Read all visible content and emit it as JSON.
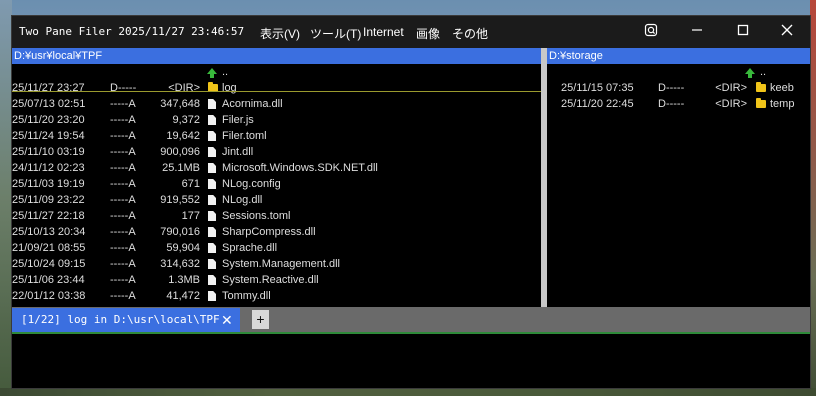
{
  "window": {
    "title": "Two Pane Filer 2025/11/27 23:46:57",
    "menu": [
      "表示(V)",
      "ツール(T)",
      "Internet",
      "画像",
      "その他"
    ]
  },
  "left_pane": {
    "path": "D:¥usr¥local¥TPF",
    "parent": "..",
    "entries": [
      {
        "date": "25/11/27 23:27",
        "attr": "D-----",
        "size": "<DIR>",
        "type": "folder",
        "name": "log"
      },
      {
        "date": "25/07/13 02:51",
        "attr": "-----A",
        "size": "347,648",
        "type": "file",
        "name": "Acornima.dll"
      },
      {
        "date": "25/11/20 23:20",
        "attr": "-----A",
        "size": "9,372",
        "type": "file",
        "name": "Filer.js"
      },
      {
        "date": "25/11/24 19:54",
        "attr": "-----A",
        "size": "19,642",
        "type": "file",
        "name": "Filer.toml"
      },
      {
        "date": "25/11/10 03:19",
        "attr": "-----A",
        "size": "900,096",
        "type": "file",
        "name": "Jint.dll"
      },
      {
        "date": "24/11/12 02:23",
        "attr": "-----A",
        "size": "25.1MB",
        "type": "file",
        "name": "Microsoft.Windows.SDK.NET.dll"
      },
      {
        "date": "25/11/03 19:19",
        "attr": "-----A",
        "size": "671",
        "type": "file",
        "name": "NLog.config"
      },
      {
        "date": "25/11/09 23:22",
        "attr": "-----A",
        "size": "919,552",
        "type": "file",
        "name": "NLog.dll"
      },
      {
        "date": "25/11/27 22:18",
        "attr": "-----A",
        "size": "177",
        "type": "file",
        "name": "Sessions.toml"
      },
      {
        "date": "25/10/13 20:34",
        "attr": "-----A",
        "size": "790,016",
        "type": "file",
        "name": "SharpCompress.dll"
      },
      {
        "date": "21/09/21 08:55",
        "attr": "-----A",
        "size": "59,904",
        "type": "file",
        "name": "Sprache.dll"
      },
      {
        "date": "25/10/24 09:15",
        "attr": "-----A",
        "size": "314,632",
        "type": "file",
        "name": "System.Management.dll"
      },
      {
        "date": "25/11/06 23:44",
        "attr": "-----A",
        "size": "1.3MB",
        "type": "file",
        "name": "System.Reactive.dll"
      },
      {
        "date": "22/01/12 03:38",
        "attr": "-----A",
        "size": "41,472",
        "type": "file",
        "name": "Tommy.dll"
      }
    ]
  },
  "right_pane": {
    "path": "D:¥storage",
    "parent": "..",
    "entries": [
      {
        "date": "25/11/15 07:35",
        "attr": "D-----",
        "size": "<DIR>",
        "type": "folder",
        "name": "keeb"
      },
      {
        "date": "25/11/20 22:45",
        "attr": "D-----",
        "size": "<DIR>",
        "type": "folder",
        "name": "temp"
      }
    ]
  },
  "tabs": {
    "active_label": "[1/22] log in D:\\usr\\local\\TPF",
    "close": "✕",
    "add": "+"
  },
  "colors": {
    "accent": "#3b6fe0",
    "folder": "#f0c419",
    "parent_arrow": "#39b93c"
  }
}
